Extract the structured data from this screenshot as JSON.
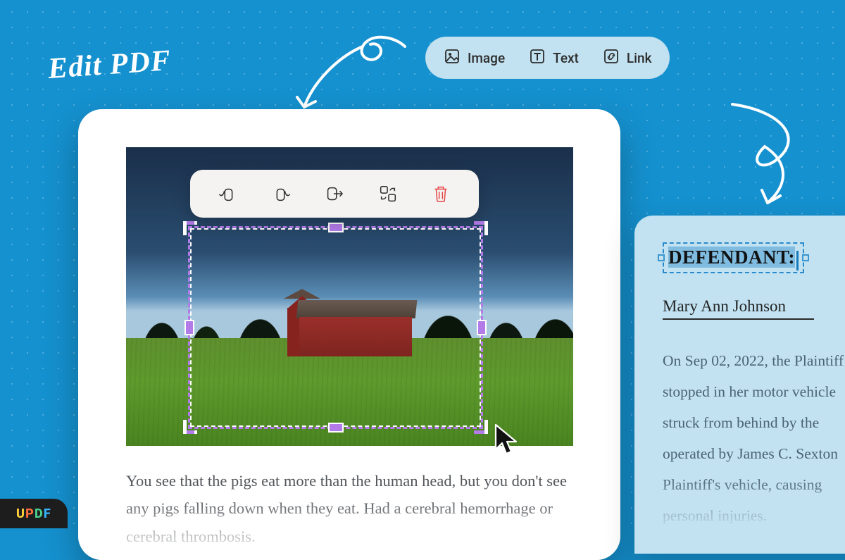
{
  "hero": {
    "title": "Edit PDF"
  },
  "toolbar": {
    "items": [
      {
        "icon": "image-icon",
        "label": "Image"
      },
      {
        "icon": "text-icon",
        "label": "Text"
      },
      {
        "icon": "link-icon",
        "label": "Link"
      }
    ]
  },
  "image_toolbar": {
    "tools": [
      {
        "name": "rotate-left-button"
      },
      {
        "name": "rotate-right-button"
      },
      {
        "name": "extract-image-button"
      },
      {
        "name": "replace-image-button"
      },
      {
        "name": "delete-image-button"
      }
    ]
  },
  "left_doc": {
    "body_text": "You see that the pigs eat more than the human head, but you don't see any pigs falling down when they eat. Had a cerebral hemorrhage or cerebral thrombosis."
  },
  "right_panel": {
    "defendant_label": "DEFENDANT:",
    "name": "Mary Ann Johnson",
    "body_text": "On Sep 02, 2022, the Plaintiff\nstopped in her motor vehicle\nstruck from behind by the\noperated by James C. Sexton\nPlaintiff's vehicle, causing\npersonal injuries."
  },
  "brand": {
    "name": "UPDF"
  }
}
